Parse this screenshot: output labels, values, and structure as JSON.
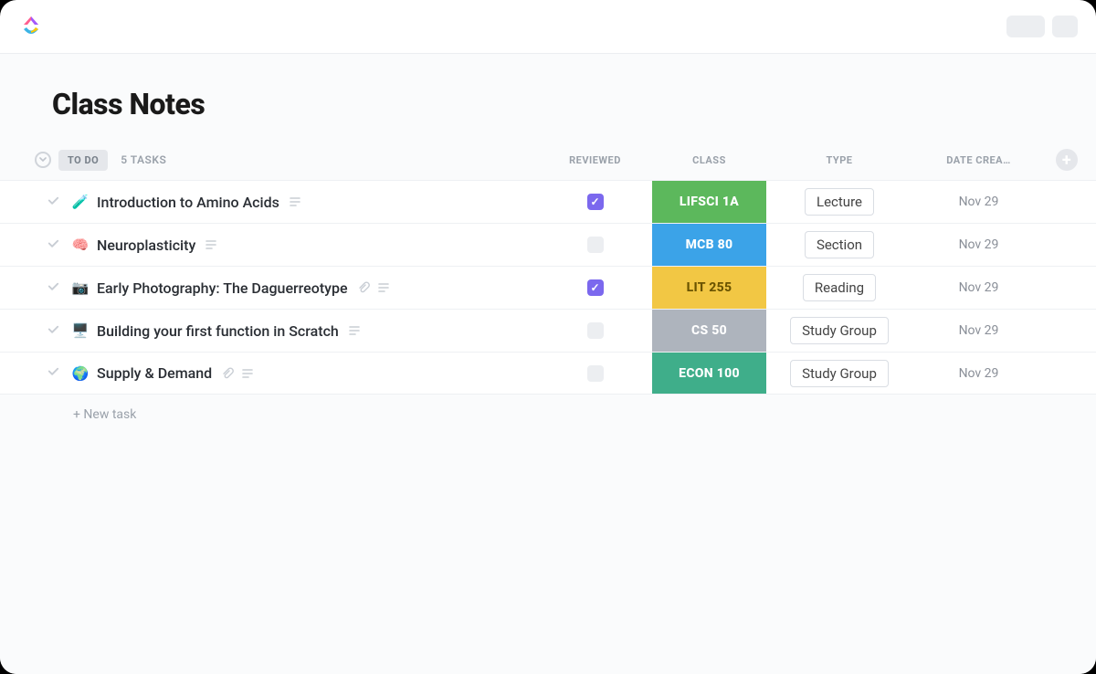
{
  "page": {
    "title": "Class Notes"
  },
  "status": {
    "label": "TO DO",
    "count_label": "5 TASKS"
  },
  "columns": {
    "reviewed": "REVIEWED",
    "class": "CLASS",
    "type": "TYPE",
    "date": "DATE CREA…"
  },
  "tasks": [
    {
      "emoji": "🧪",
      "title": "Introduction to Amino Acids",
      "has_desc": true,
      "has_attach": false,
      "reviewed": true,
      "class": "LIFSCI 1A",
      "class_color": "#5cb85c",
      "type": "Lecture",
      "date": "Nov 29"
    },
    {
      "emoji": "🧠",
      "title": "Neuroplasticity",
      "has_desc": true,
      "has_attach": false,
      "reviewed": false,
      "class": "MCB 80",
      "class_color": "#3ba3e8",
      "type": "Section",
      "date": "Nov 29"
    },
    {
      "emoji": "📷",
      "title": "Early Photography: The Daguerreotype",
      "has_desc": true,
      "has_attach": true,
      "reviewed": true,
      "class": "LIT 255",
      "class_color": "#f2c744",
      "class_text": "#6b5400",
      "type": "Reading",
      "date": "Nov 29"
    },
    {
      "emoji": "🖥️",
      "title": "Building your first function in Scratch",
      "has_desc": true,
      "has_attach": false,
      "reviewed": false,
      "class": "CS 50",
      "class_color": "#aeb4bd",
      "type": "Study Group",
      "date": "Nov 29"
    },
    {
      "emoji": "🌍",
      "title": "Supply & Demand",
      "has_desc": true,
      "has_attach": true,
      "reviewed": false,
      "class": "ECON 100",
      "class_color": "#3fae8a",
      "type": "Study Group",
      "date": "Nov 29"
    }
  ],
  "new_task_label": "+ New task"
}
